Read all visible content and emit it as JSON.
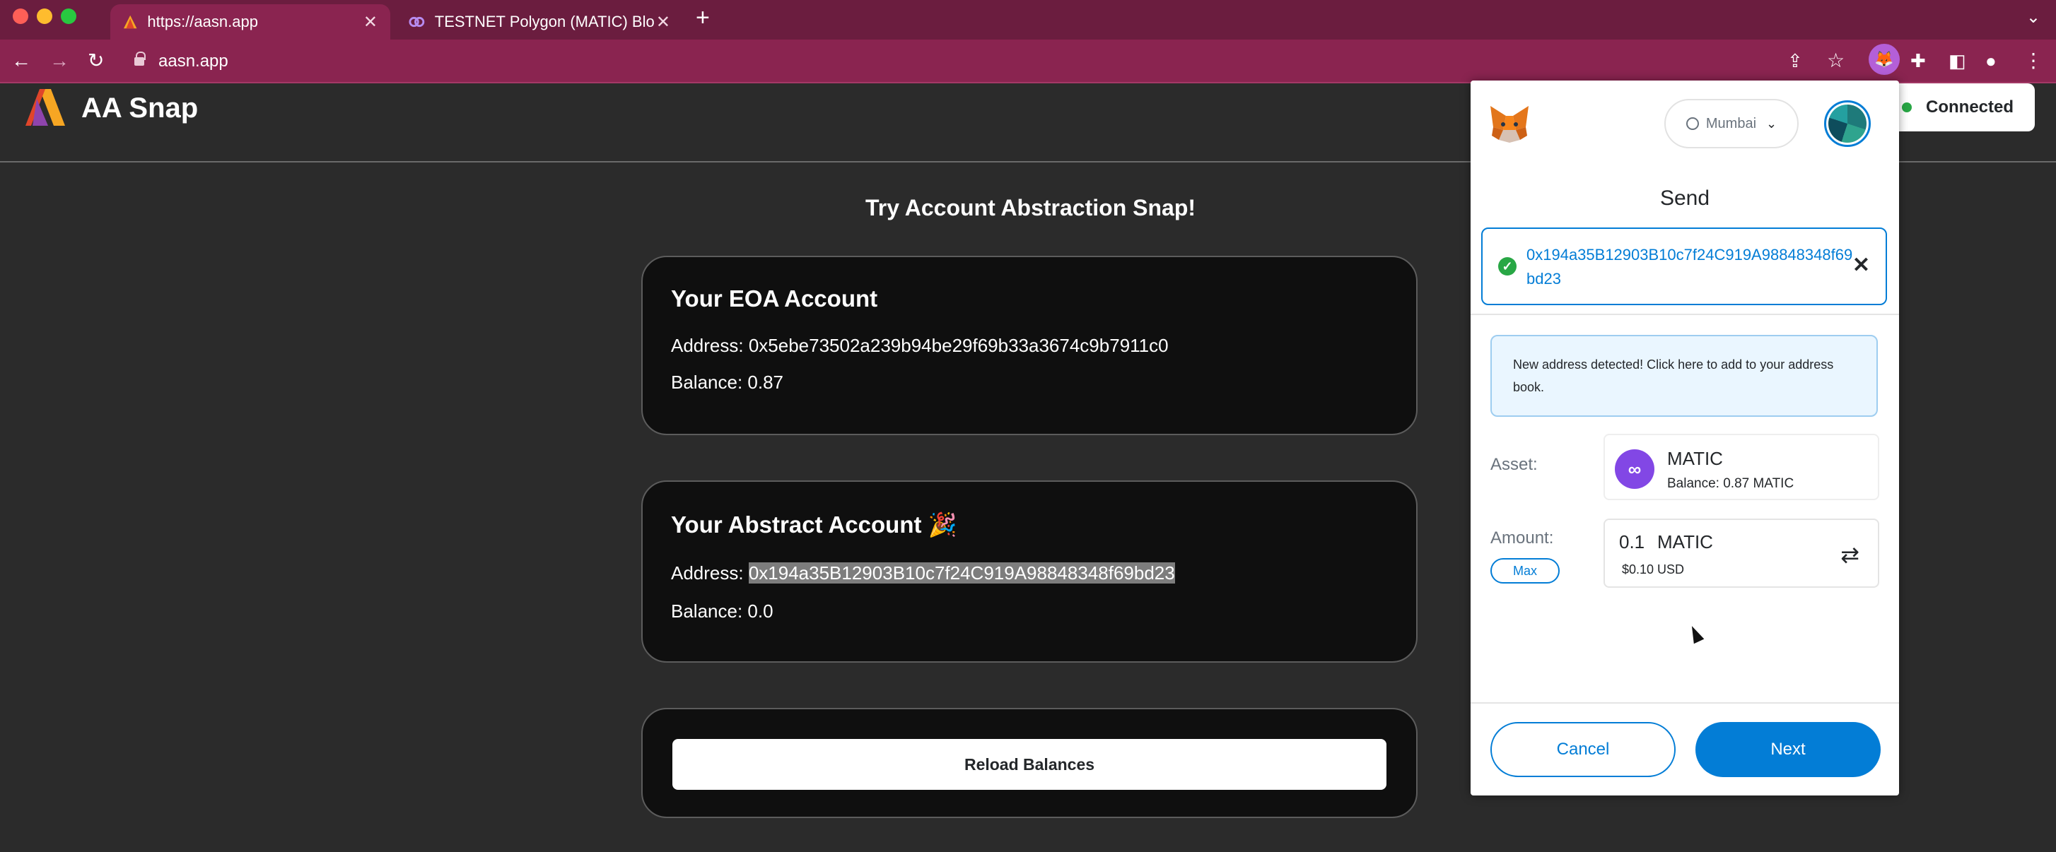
{
  "browser": {
    "tabs": [
      {
        "title": "https://aasn.app",
        "active": true
      },
      {
        "title": "TESTNET Polygon (MATIC) Blo",
        "active": false
      }
    ],
    "address_bar": "aasn.app",
    "new_tab": "+",
    "tab_menu": "⌄"
  },
  "app": {
    "title": "AA Snap",
    "connected_label": "Connected",
    "page_title": "Try Account Abstraction Snap!",
    "eoa": {
      "heading": "Your EOA Account",
      "address_line": "Address: 0x5ebe73502a239b94be29f69b33a3674c9b7911c0",
      "balance_line": "Balance: 0.87"
    },
    "abstract": {
      "heading": "Your Abstract Account 🎉",
      "address_label": "Address: ",
      "address": "0x194a35B12903B10c7f24C919A98848348f69bd23",
      "balance_line": "Balance: 0.0"
    },
    "reload_label": "Reload Balances"
  },
  "metamask": {
    "network": "Mumbai",
    "send_title": "Send",
    "recipient": "0x194a35B12903B10c7f24C919A98848348f69bd23",
    "notice": "New address detected! Click here to add to your address book.",
    "asset_label": "Asset:",
    "asset_name": "MATIC",
    "asset_balance": "Balance:   0.87 MATIC",
    "amount_label": "Amount:",
    "amount_value": "0.1",
    "amount_currency": "MATIC",
    "amount_usd": "$0.10 USD",
    "max_label": "Max",
    "cancel_label": "Cancel",
    "next_label": "Next"
  },
  "colors": {
    "tabbar": "#6b1d3f",
    "toolbar": "#8a2450",
    "metamask_blue": "#037dd6",
    "polygon_purple": "#8247e5",
    "connected_green": "#28a745"
  },
  "icons": [
    "back-icon",
    "forward-icon",
    "reload-icon",
    "lock-icon",
    "share-icon",
    "star-icon",
    "metamask-extension-icon",
    "puzzle-icon",
    "sidepanel-icon",
    "profile-icon",
    "kebab-menu-icon",
    "fox-icon",
    "network-icon",
    "chevron-down-icon",
    "check-icon",
    "close-icon",
    "matic-icon",
    "swap-icon"
  ]
}
